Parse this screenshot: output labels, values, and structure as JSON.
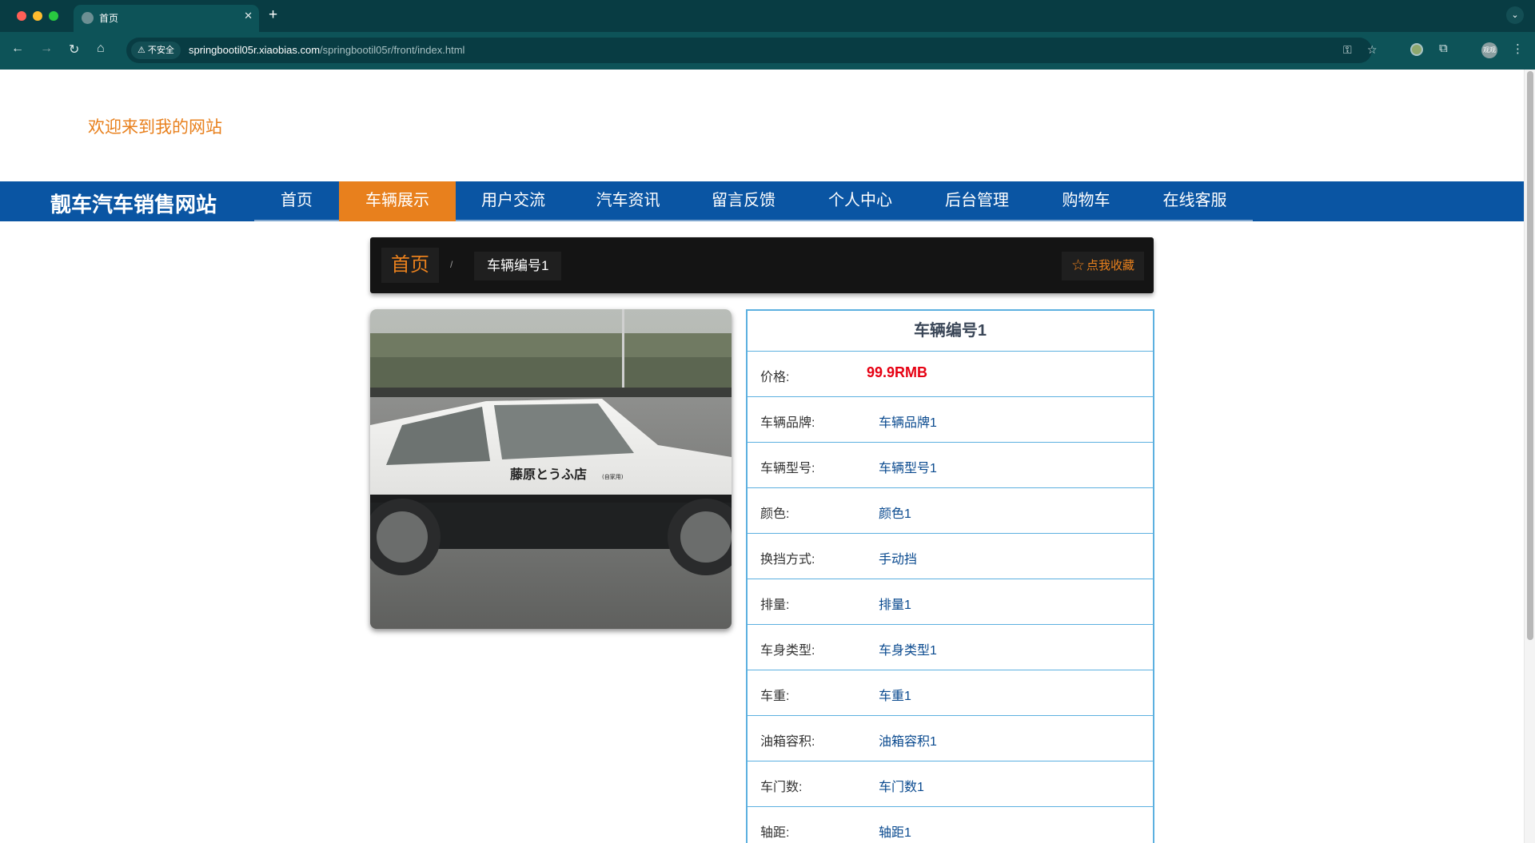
{
  "browser": {
    "tab_title": "首页",
    "tab_close": "✕",
    "new_tab": "+",
    "tab_menu": "⌄",
    "security_label": "⚠ 不安全",
    "url_host": "springbootil05r.xiaobias.com",
    "url_path": "/springbootil05r/front/index.html",
    "icons": [
      "back-icon",
      "forward-icon",
      "reload-icon",
      "home-icon",
      "password-key-icon",
      "bookmark-star-icon",
      "extension-icon",
      "extensions-puzzle-icon",
      "profile-avatar-icon",
      "more-menu-icon"
    ],
    "avatar_text": "观观"
  },
  "site": {
    "welcome": "欢迎来到我的网站",
    "title": "靓车汽车销售网站",
    "nav": [
      "首页",
      "车辆展示",
      "用户交流",
      "汽车资讯",
      "留言反馈",
      "个人中心",
      "后台管理",
      "购物车",
      "在线客服"
    ],
    "active_nav": "车辆展示",
    "colors": {
      "nav_bg": "#0a55a3",
      "accent": "#e8801d",
      "price": "#e60012",
      "border": "#5cb0e0"
    }
  },
  "breadcrumb": {
    "home": "首页",
    "separator": "/",
    "current": "车辆编号1",
    "collect": "点我收藏",
    "collect_icon": "☆"
  },
  "vehicle": {
    "title": "车辆编号1",
    "photo_text": "藤原とうふ店",
    "photo_small_text": "(自家用)",
    "fields": [
      {
        "label": "价格:",
        "value": "99.9RMB"
      },
      {
        "label": "车辆品牌:",
        "value": "车辆品牌1"
      },
      {
        "label": "车辆型号:",
        "value": "车辆型号1"
      },
      {
        "label": "颜色:",
        "value": "颜色1"
      },
      {
        "label": "换挡方式:",
        "value": "手动挡"
      },
      {
        "label": "排量:",
        "value": "排量1"
      },
      {
        "label": "车身类型:",
        "value": "车身类型1"
      },
      {
        "label": "车重:",
        "value": "车重1"
      },
      {
        "label": "油箱容积:",
        "value": "油箱容积1"
      },
      {
        "label": "车门数:",
        "value": "车门数1"
      },
      {
        "label": "轴距:",
        "value": "轴距1"
      }
    ]
  }
}
